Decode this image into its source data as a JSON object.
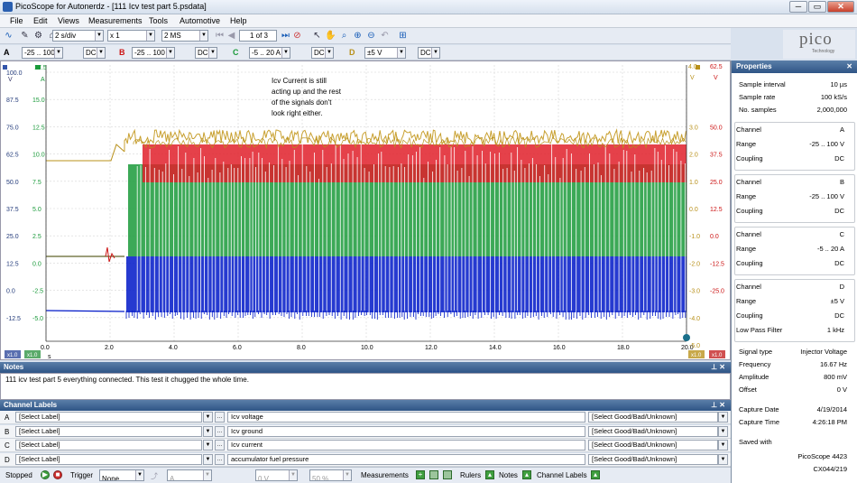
{
  "window": {
    "title": "PicoScope for Autonerdz - [111 Icv test part 5.psdata]",
    "buttons": [
      "─",
      "▭",
      "✕"
    ]
  },
  "menu": [
    "File",
    "Edit",
    "Views",
    "Measurements",
    "Tools",
    "Automotive",
    "Help"
  ],
  "toolbar": {
    "timebase": "2 s/div",
    "zoom": "x 1",
    "samples": "2 MS",
    "buffer": "1 of 3"
  },
  "channels": [
    {
      "letter": "A",
      "range": "-25 .. 100 V",
      "coupling": "DC",
      "color": "#cc1414"
    },
    {
      "letter": "B",
      "range": "-25 .. 100 V",
      "coupling": "DC",
      "color": "#cc1414"
    },
    {
      "letter": "C",
      "range": "-5 .. 20 A",
      "coupling": "DC",
      "color": "#1a9a3a"
    },
    {
      "letter": "D",
      "range": "±5 V",
      "coupling": "DC",
      "color": "#b8901a"
    }
  ],
  "logo": {
    "name": "pico",
    "tagline": "Technology"
  },
  "scope": {
    "unit_left1": "V",
    "unit_left2": "A",
    "unit_right1": "V",
    "unit_right2": "V",
    "top_left1": "17.5",
    "top_right1": "4.0",
    "top_right2": "62.5",
    "axisA": [
      "100.0",
      "87.5",
      "75.0",
      "62.5",
      "50.0",
      "37.5",
      "25.0",
      "12.5",
      "0.0",
      "-12.5"
    ],
    "axisC": [
      "15.0",
      "12.5",
      "10.0",
      "7.5",
      "5.0",
      "2.5",
      "0.0",
      "-2.5",
      "-5.0"
    ],
    "axisD": [
      "3.0",
      "2.0",
      "1.0",
      "0.0",
      "-1.0",
      "-2.0",
      "-3.0",
      "-4.0",
      "-5.0"
    ],
    "axisB": [
      "50.0",
      "37.5",
      "25.0",
      "12.5",
      "0.0",
      "-12.5",
      "-25.0"
    ],
    "bottom_tags": [
      "x1.0",
      "x1.0",
      "x1.0",
      "x1.0"
    ],
    "xticks": [
      "0.0",
      "2.0",
      "4.0",
      "6.0",
      "8.0",
      "10.0",
      "12.0",
      "14.0",
      "16.0",
      "18.0",
      "20.0"
    ],
    "xunit": "s",
    "annotation": [
      "Icv Current is still",
      "acting up and the rest",
      "of the signals don't",
      "look right either."
    ]
  },
  "notes": {
    "header": "Notes",
    "text": "111 icv test part 5 everything connected.  This test it chugged the whole time."
  },
  "channel_labels": {
    "header": "Channel Labels",
    "rows": [
      {
        "letter": "A",
        "label": "[Select Label]",
        "desc": "Icv voltage",
        "status": "[Select Good/Bad/Unknown]"
      },
      {
        "letter": "B",
        "label": "[Select Label]",
        "desc": "Icv ground",
        "status": "[Select Good/Bad/Unknown]"
      },
      {
        "letter": "C",
        "label": "[Select Label]",
        "desc": "Icv current",
        "status": "[Select Good/Bad/Unknown]"
      },
      {
        "letter": "D",
        "label": "[Select Label]",
        "desc": "accumulator fuel pressure",
        "status": "[Select Good/Bad/Unknown]"
      }
    ]
  },
  "status": {
    "state": "Stopped",
    "trigger_label": "Trigger",
    "trigger": "None",
    "trig_ch": "A",
    "trig_level": "0 V",
    "trig_pct": "50 %",
    "measurements": "Measurements",
    "rulers": "Rulers",
    "notes": "Notes",
    "channel_labels": "Channel Labels"
  },
  "properties": {
    "header": "Properties",
    "general": [
      [
        "Sample interval",
        "10 µs"
      ],
      [
        "Sample rate",
        "100 kS/s"
      ],
      [
        "No. samples",
        "2,000,000"
      ]
    ],
    "channels": [
      [
        [
          "Channel",
          "A"
        ],
        [
          "Range",
          "-25 .. 100 V"
        ],
        [
          "Coupling",
          "DC"
        ]
      ],
      [
        [
          "Channel",
          "B"
        ],
        [
          "Range",
          "-25 .. 100 V"
        ],
        [
          "Coupling",
          "DC"
        ]
      ],
      [
        [
          "Channel",
          "C"
        ],
        [
          "Range",
          "-5 .. 20 A"
        ],
        [
          "Coupling",
          "DC"
        ]
      ],
      [
        [
          "Channel",
          "D"
        ],
        [
          "Range",
          "±5 V"
        ],
        [
          "Coupling",
          "DC"
        ],
        [
          "Low Pass Filter",
          "1 kHz"
        ]
      ]
    ],
    "signal": [
      [
        "Signal type",
        "Injector Voltage"
      ],
      [
        "Frequency",
        "16.67 Hz"
      ],
      [
        "Amplitude",
        "800 mV"
      ],
      [
        "Offset",
        "0 V"
      ]
    ],
    "capture": [
      [
        "Capture Date",
        "4/19/2014"
      ],
      [
        "Capture Time",
        "4:26:18 PM"
      ]
    ],
    "saved": {
      "label": "Saved with",
      "product": "PicoScope 4423",
      "serial": "CX044/219"
    }
  }
}
